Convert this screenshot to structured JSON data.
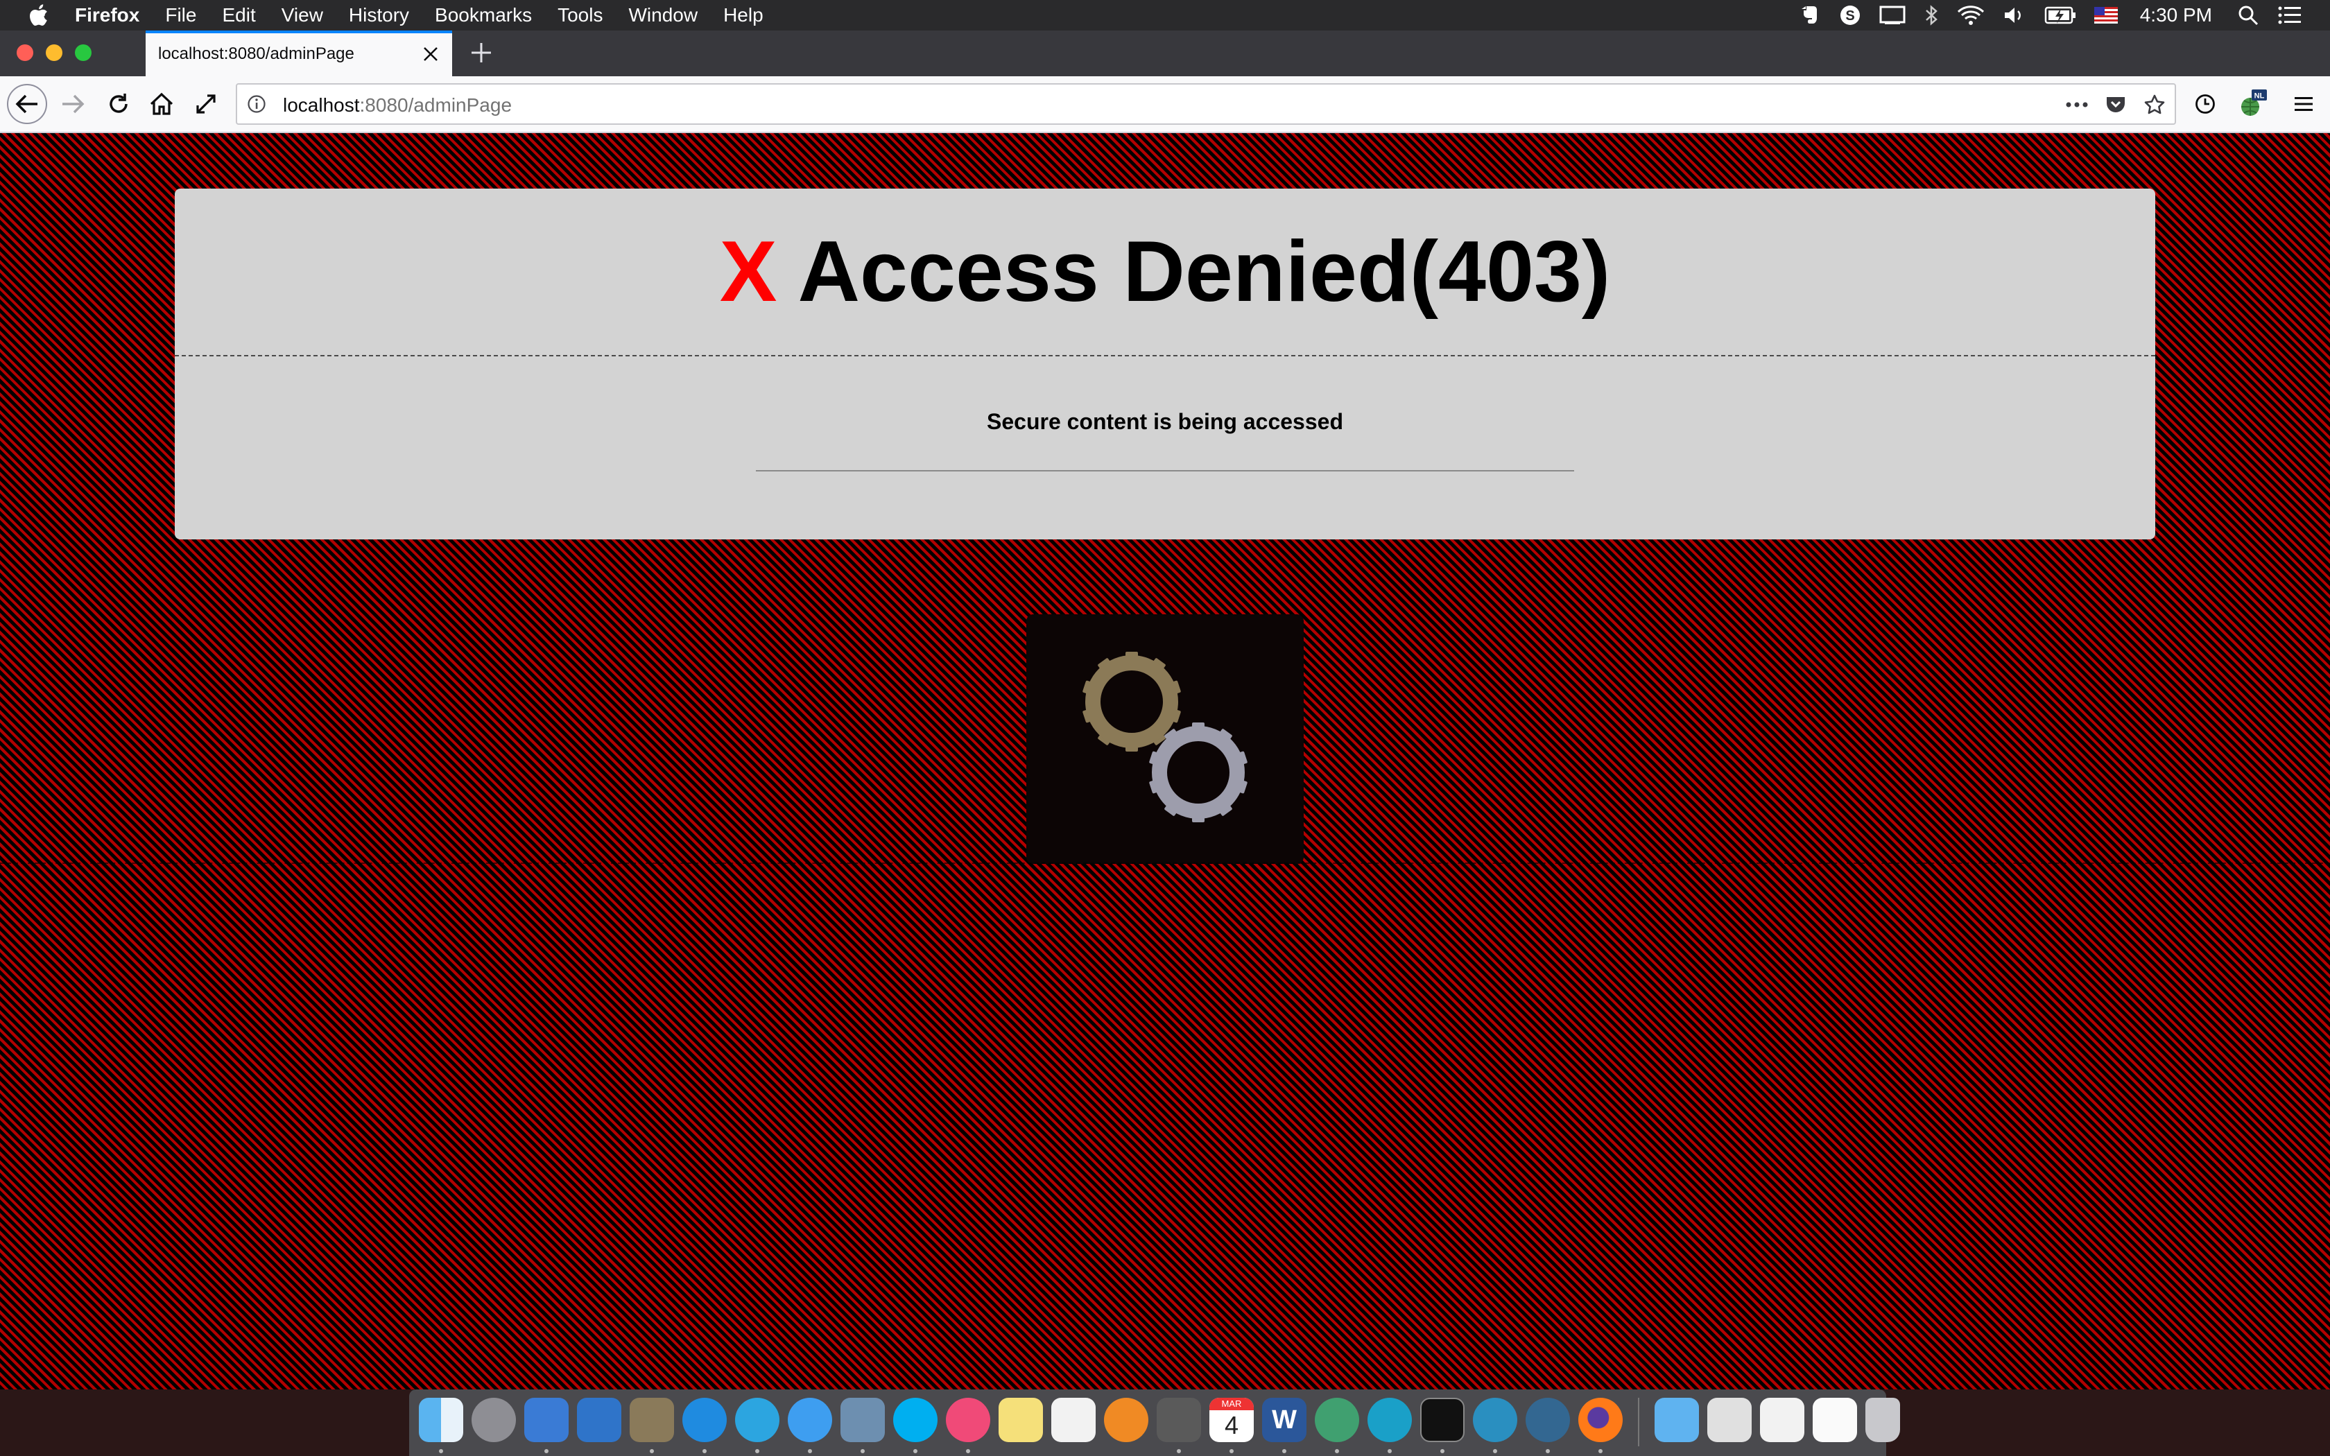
{
  "menubar": {
    "app_name": "Firefox",
    "items": [
      "File",
      "Edit",
      "View",
      "History",
      "Bookmarks",
      "Tools",
      "Window",
      "Help"
    ],
    "clock": "4:30 PM"
  },
  "tab": {
    "title": "localhost:8080/adminPage"
  },
  "urlbar": {
    "host": "localhost",
    "path": ":8080/adminPage"
  },
  "toolbar": {
    "badge": "NL"
  },
  "page": {
    "title_mark": "X",
    "title": "Access Denied(403)",
    "message": "Secure content is being accessed"
  },
  "dock": {
    "calendar_month": "MAR",
    "calendar_day": "4",
    "word_letter": "W"
  },
  "colors": {
    "x_mark": "#ff0000",
    "page_stripe": "#b30000",
    "card_bg": "#d3d3d3",
    "gear_gold": "#8b7a57",
    "gear_silver": "#9d9dac",
    "tab_accent": "#0a84ff"
  }
}
